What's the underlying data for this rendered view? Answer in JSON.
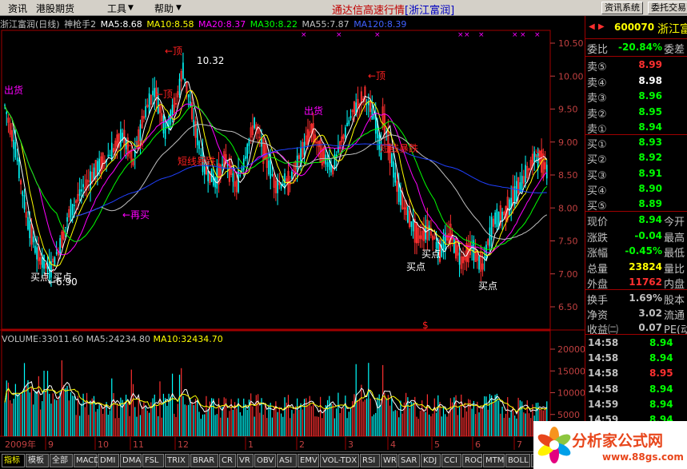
{
  "menu": {
    "items": [
      "资讯",
      "港股期货",
      "工具",
      "帮助"
    ],
    "title_prefix": "通达信高速行情",
    "title_stock": "[浙江富润]",
    "btn_info": "资讯系统",
    "btn_trade": "委托交易"
  },
  "chart_header": {
    "name": "浙江富润(日线)",
    "indicator": "神枪手2",
    "ma5": "MA5:8.68",
    "ma10": "MA10:8.58",
    "ma20": "MA20:8.37",
    "ma30": "MA30:8.22",
    "ma55": "MA55:7.87",
    "ma120": "MA120:8.39"
  },
  "colors": {
    "ma5": "#ffffff",
    "ma10": "#ffff00",
    "ma20": "#ff00ff",
    "ma30": "#00ff00",
    "ma55": "#c0c0c0",
    "ma120": "#2040ff",
    "up": "#ff3030",
    "down": "#00ffff",
    "magenta": "#ff00ff",
    "red_label": "#ff2020",
    "white": "#ffffff"
  },
  "annotations": {
    "sell1": "出货",
    "top1": "←顶",
    "top_value": "10.32",
    "top2": "←顶",
    "top3": "←顶",
    "top4": "←顶",
    "short_break1": "短线暴跌",
    "short_break2": "短线暴跌",
    "buy_again": "←再买",
    "low_value": "←6.90",
    "buy_a": "买点",
    "buy_b": "买点",
    "sell2": "出货",
    "buy_c": "买点",
    "buy_d": "买点",
    "buy_e": "买点",
    "sell3": "出",
    "dollar": "$"
  },
  "price_axis": [
    "10.50",
    "10.00",
    "9.50",
    "9.00",
    "8.50",
    "8.00",
    "7.50",
    "7.00",
    "6.50"
  ],
  "volume_header": {
    "volume": "VOLUME:33011.60",
    "ma5": "MA5:24234.80",
    "ma10": "MA10:32434.70"
  },
  "volume_axis": [
    "20000",
    "15000",
    "10000",
    "5000"
  ],
  "date_axis": {
    "year": "2009年",
    "months": [
      "9",
      "10",
      "11",
      "12",
      "1",
      "2",
      "3",
      "4",
      "5",
      "6",
      "7",
      "8"
    ]
  },
  "right_panel": {
    "code": "600070",
    "name": "浙江富",
    "webi_label": "委比",
    "webi_value": "-20.84%",
    "wecha_label": "委差",
    "sell": [
      {
        "label": "卖⑤",
        "price": "8.99"
      },
      {
        "label": "卖④",
        "price": "8.98"
      },
      {
        "label": "卖③",
        "price": "8.96"
      },
      {
        "label": "卖②",
        "price": "8.95"
      },
      {
        "label": "卖①",
        "price": "8.94"
      }
    ],
    "buy": [
      {
        "label": "买①",
        "price": "8.93"
      },
      {
        "label": "买②",
        "price": "8.92"
      },
      {
        "label": "买③",
        "price": "8.91"
      },
      {
        "label": "买④",
        "price": "8.90"
      },
      {
        "label": "买⑤",
        "price": "8.89"
      }
    ],
    "quote": [
      {
        "label": "现价",
        "value": "8.94",
        "extra": "今开",
        "color": "#00ff00"
      },
      {
        "label": "涨跌",
        "value": "-0.04",
        "extra": "最高",
        "color": "#00ff00"
      },
      {
        "label": "涨幅",
        "value": "-0.45%",
        "extra": "最低",
        "color": "#00ff00"
      },
      {
        "label": "总量",
        "value": "23824",
        "extra": "量比",
        "color": "#ffff00"
      },
      {
        "label": "外盘",
        "value": "11762",
        "extra": "内盘",
        "color": "#ff3030"
      }
    ],
    "fund": [
      {
        "label": "换手",
        "value": "1.69%",
        "extra": "股本"
      },
      {
        "label": "净资",
        "value": "3.02",
        "extra": "流通"
      },
      {
        "label": "收益㈡",
        "value": "0.07",
        "extra": "PE(动"
      }
    ],
    "ticks": [
      {
        "time": "14:58",
        "price": "8.94",
        "color": "#00ff00"
      },
      {
        "time": "14:58",
        "price": "8.94",
        "color": "#00ff00"
      },
      {
        "time": "14:58",
        "price": "8.95",
        "color": "#ff3030"
      },
      {
        "time": "14:58",
        "price": "8.94",
        "color": "#00ff00"
      },
      {
        "time": "14:59",
        "price": "8.94",
        "color": "#00ff00"
      },
      {
        "time": "14:59",
        "price": "8.94",
        "color": "#00ff00"
      },
      {
        "time": "14:59",
        "price": "8.94",
        "color": "#00ff00"
      }
    ]
  },
  "tabs": [
    "指标",
    "模板",
    "全部",
    "MACD",
    "DMI",
    "DMA",
    "FSL",
    "TRIX",
    "BRAR",
    "CR",
    "VR",
    "OBV",
    "ASI",
    "EMV",
    "VOL-TDX",
    "RSI",
    "WR",
    "SAR",
    "KDJ",
    "CCI",
    "ROC",
    "MTM",
    "BOLL",
    "PSY"
  ],
  "watermark": {
    "text": "分析家公式网",
    "url": "www.88gs.com"
  }
}
